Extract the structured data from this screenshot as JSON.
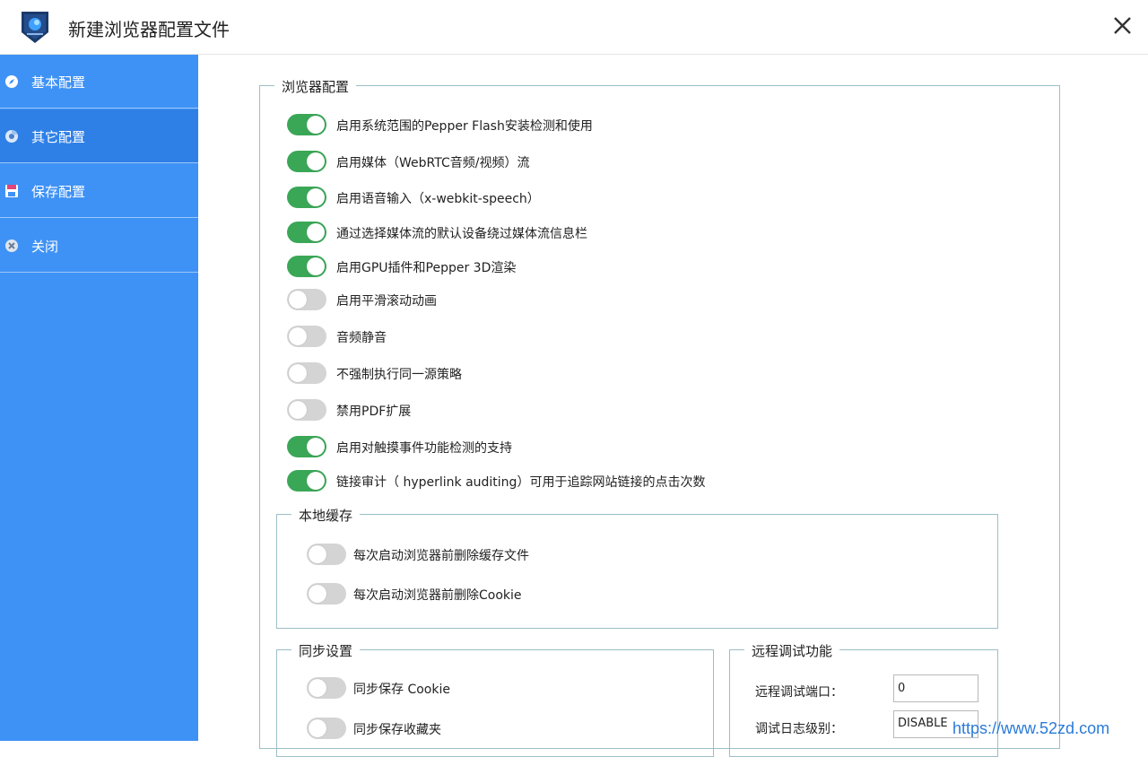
{
  "window": {
    "title": "新建浏览器配置文件"
  },
  "sidebar": {
    "items": [
      {
        "label": "基本配置",
        "icon": "compass-icon",
        "active": false
      },
      {
        "label": "其它配置",
        "icon": "chrome-icon",
        "active": true
      },
      {
        "label": "保存配置",
        "icon": "save-icon",
        "active": false
      },
      {
        "label": "关闭",
        "icon": "close-circle-icon",
        "active": false
      }
    ]
  },
  "browser_config": {
    "title": "浏览器配置",
    "options": [
      {
        "label": "启用系统范围的Pepper Flash安装检测和使用",
        "on": true
      },
      {
        "label": "启用媒体（WebRTC音频/视频）流",
        "on": true
      },
      {
        "label": "启用语音输入（x-webkit-speech）",
        "on": true
      },
      {
        "label": "通过选择媒体流的默认设备绕过媒体流信息栏",
        "on": true
      },
      {
        "label": "启用GPU插件和Pepper 3D渲染",
        "on": true
      },
      {
        "label": "启用平滑滚动动画",
        "on": false
      },
      {
        "label": "音频静音",
        "on": false
      },
      {
        "label": "不强制执行同一源策略",
        "on": false
      },
      {
        "label": "禁用PDF扩展",
        "on": false
      },
      {
        "label": "启用对触摸事件功能检测的支持",
        "on": true
      },
      {
        "label": "链接审计（ hyperlink auditing）可用于追踪网站链接的点击次数",
        "on": true
      }
    ]
  },
  "local_cache": {
    "title": "本地缓存",
    "options": [
      {
        "label": "每次启动浏览器前删除缓存文件",
        "on": false
      },
      {
        "label": "每次启动浏览器前删除Cookie",
        "on": false
      }
    ]
  },
  "sync": {
    "title": "同步设置",
    "options": [
      {
        "label": "同步保存 Cookie",
        "on": false
      },
      {
        "label": "同步保存收藏夹",
        "on": false
      }
    ]
  },
  "remote_debug": {
    "title": "远程调试功能",
    "port_label": "远程调试端口：",
    "port_value": "0",
    "log_label": "调试日志级别：",
    "log_value": "DISABLE"
  },
  "watermark": "https://www.52zd.com",
  "colors": {
    "sidebar": "#3f92f5",
    "toggle_on": "#3aa757",
    "toggle_off": "#d4d4d4",
    "group_border": "#9bbfc6"
  }
}
